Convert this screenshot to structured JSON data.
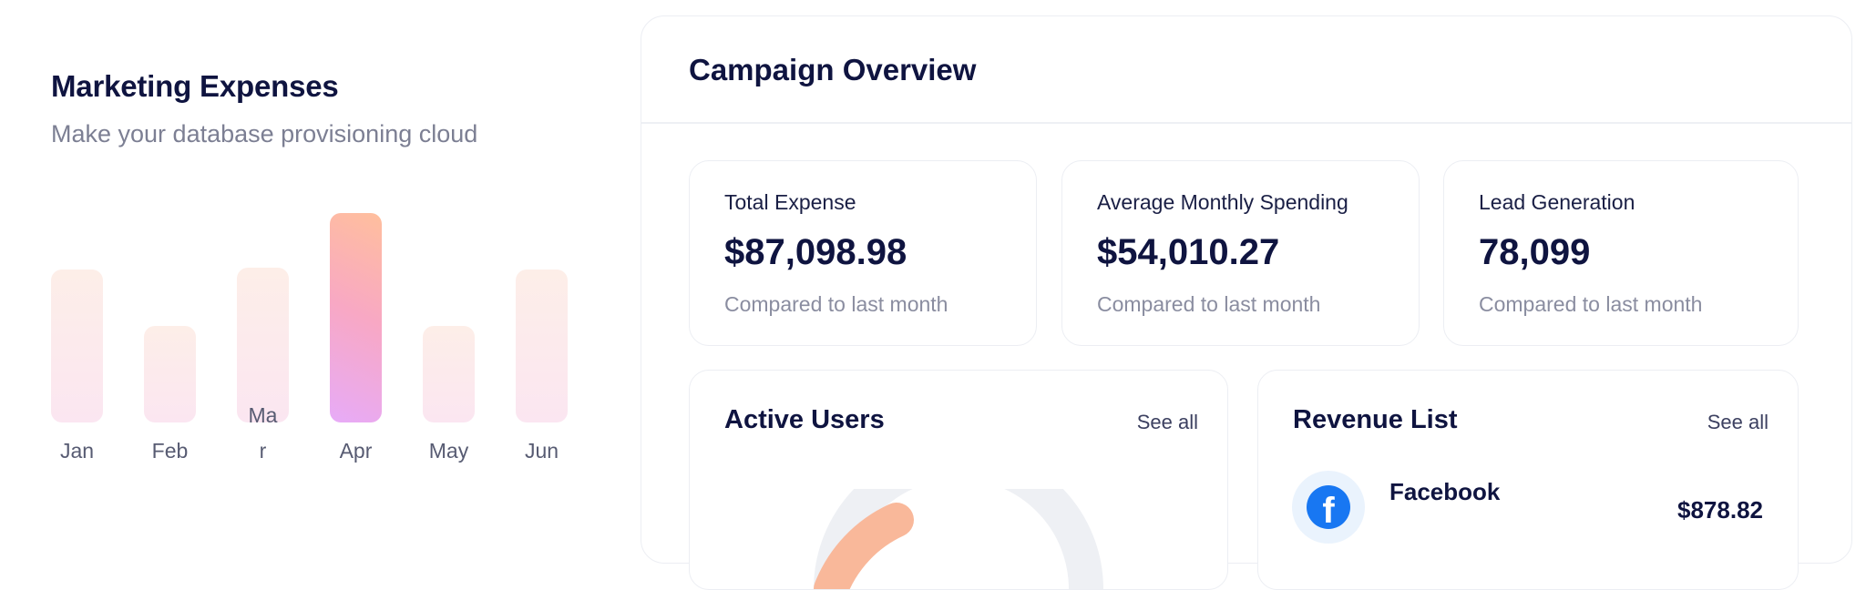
{
  "marketing": {
    "title": "Marketing Expenses",
    "subtitle": "Make your database provisioning cloud"
  },
  "chart_data": {
    "type": "bar",
    "categories": [
      "Jan",
      "Feb",
      "Mar",
      "Apr",
      "May",
      "Jun"
    ],
    "values": [
      70,
      44,
      71,
      96,
      44,
      70
    ],
    "highlighted": "Apr",
    "colors": {
      "bar": "#fdecee",
      "active_start": "#ffbf9d",
      "active_end": "#e7abf8"
    }
  },
  "overview": {
    "title": "Campaign Overview",
    "stats": [
      {
        "label": "Total Expense",
        "value": "$87,098.98",
        "note": "Compared to last month"
      },
      {
        "label": "Average Monthly Spending",
        "value": "$54,010.27",
        "note": "Compared to last month"
      },
      {
        "label": "Lead Generation",
        "value": "78,099",
        "note": "Compared to last month"
      }
    ],
    "active_users": {
      "title": "Active Users",
      "see_all": "See all",
      "accent_color": "#f9b89a",
      "track_color": "#eef0f4"
    },
    "revenue": {
      "title": "Revenue List",
      "see_all": "See all",
      "items": [
        {
          "name": "Facebook",
          "amount": "$878.82",
          "icon": "facebook-icon"
        }
      ]
    }
  }
}
